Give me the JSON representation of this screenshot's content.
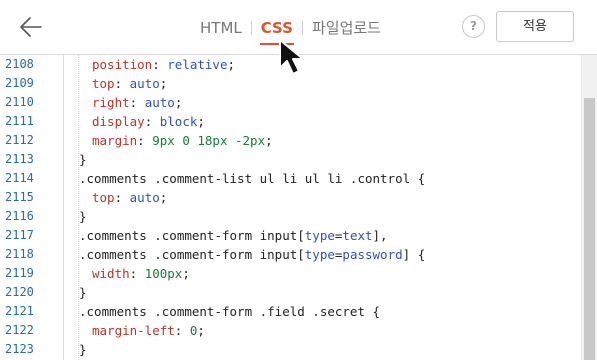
{
  "toolbar": {
    "back_icon": "arrow-left-icon",
    "tabs": [
      {
        "label": "HTML",
        "active": false
      },
      {
        "label": "CSS",
        "active": true
      },
      {
        "label": "파일업로드",
        "active": false
      }
    ],
    "help_label": "?",
    "apply_label": "적용",
    "accent_color": "#e0532c"
  },
  "editor": {
    "lines": [
      {
        "n": "2108",
        "tokens": [
          [
            "position",
            "prop"
          ],
          [
            ": ",
            "punc"
          ],
          [
            "relative",
            "val"
          ],
          [
            ";",
            "punc"
          ]
        ],
        "inner": true
      },
      {
        "n": "2109",
        "tokens": [
          [
            "top",
            "prop"
          ],
          [
            ": ",
            "punc"
          ],
          [
            "auto",
            "val"
          ],
          [
            ";",
            "punc"
          ]
        ],
        "inner": true
      },
      {
        "n": "2110",
        "tokens": [
          [
            "right",
            "prop"
          ],
          [
            ": ",
            "punc"
          ],
          [
            "auto",
            "val"
          ],
          [
            ";",
            "punc"
          ]
        ],
        "inner": true
      },
      {
        "n": "2111",
        "tokens": [
          [
            "display",
            "prop"
          ],
          [
            ": ",
            "punc"
          ],
          [
            "block",
            "val"
          ],
          [
            ";",
            "punc"
          ]
        ],
        "inner": true
      },
      {
        "n": "2112",
        "tokens": [
          [
            "margin",
            "prop"
          ],
          [
            ": ",
            "punc"
          ],
          [
            "9px 0 18px -2px",
            "num"
          ],
          [
            ";",
            "punc"
          ]
        ],
        "inner": true
      },
      {
        "n": "2113",
        "tokens": [
          [
            "}",
            "punc"
          ]
        ],
        "inner": false
      },
      {
        "n": "2114",
        "tokens": [
          [
            ".comments .comment-list ul li ul li .control {",
            "sel"
          ]
        ],
        "inner": false
      },
      {
        "n": "2115",
        "tokens": [
          [
            "top",
            "prop"
          ],
          [
            ": ",
            "punc"
          ],
          [
            "auto",
            "val"
          ],
          [
            ";",
            "punc"
          ]
        ],
        "inner": true
      },
      {
        "n": "2116",
        "tokens": [
          [
            "}",
            "punc"
          ]
        ],
        "inner": false
      },
      {
        "n": "2117",
        "tokens": [
          [
            ".comments .comment-form input[",
            "sel"
          ],
          [
            "type",
            "attr"
          ],
          [
            "=",
            "punc"
          ],
          [
            "text",
            "attr"
          ],
          [
            "],",
            "sel"
          ]
        ],
        "inner": false
      },
      {
        "n": "2118",
        "tokens": [
          [
            ".comments .comment-form input[",
            "sel"
          ],
          [
            "type",
            "attr"
          ],
          [
            "=",
            "punc"
          ],
          [
            "password",
            "attr"
          ],
          [
            "] {",
            "sel"
          ]
        ],
        "inner": false
      },
      {
        "n": "2119",
        "tokens": [
          [
            "width",
            "prop"
          ],
          [
            ": ",
            "punc"
          ],
          [
            "100px",
            "num"
          ],
          [
            ";",
            "punc"
          ]
        ],
        "inner": true
      },
      {
        "n": "2120",
        "tokens": [
          [
            "}",
            "punc"
          ]
        ],
        "inner": false
      },
      {
        "n": "2121",
        "tokens": [
          [
            ".comments .comment-form .field .secret {",
            "sel"
          ]
        ],
        "inner": false
      },
      {
        "n": "2122",
        "tokens": [
          [
            "margin-left",
            "prop"
          ],
          [
            ": ",
            "punc"
          ],
          [
            "0",
            "num"
          ],
          [
            ";",
            "punc"
          ]
        ],
        "inner": true
      },
      {
        "n": "2123",
        "tokens": [
          [
            "}",
            "punc"
          ]
        ],
        "inner": false
      }
    ]
  },
  "cursor_icon": "mouse-pointer-icon"
}
